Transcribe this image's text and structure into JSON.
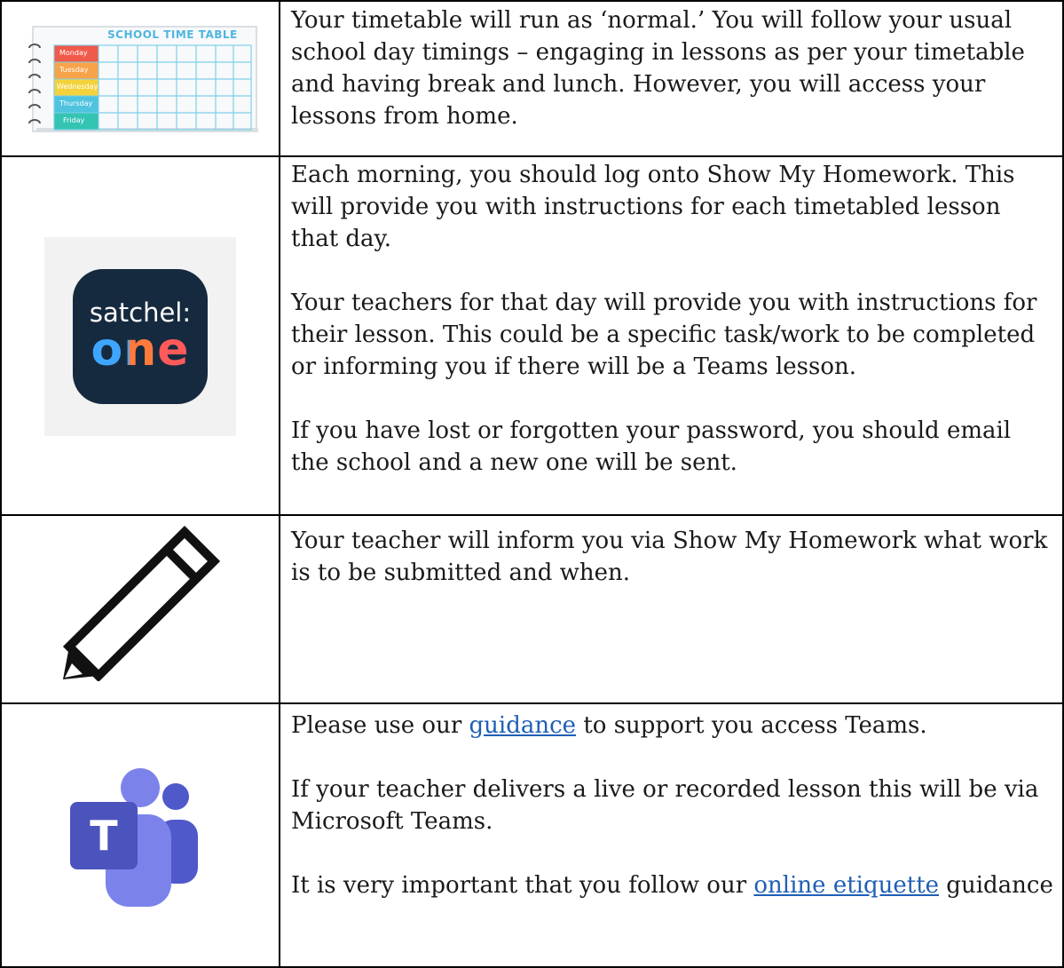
{
  "rows": [
    {
      "icon": "timetable-icon",
      "image_title": "SCHOOL TIME TABLE",
      "days": [
        "Monday",
        "Tuesday",
        "Wednesday",
        "Thursday",
        "Friday"
      ],
      "day_colors": [
        "#f05a4a",
        "#f7a34a",
        "#f4d23c",
        "#4fc3e0",
        "#34c4b2"
      ],
      "paragraphs": [
        "Your timetable will run as ‘normal.’ You will follow your usual school day timings – engaging in lessons as per your timetable and having break and lunch. However, you will access your lessons from home."
      ]
    },
    {
      "icon": "satchel-one-logo",
      "logo_line1": "satchel:",
      "logo_line2": "one",
      "paragraphs": [
        "Each morning, you should log onto Show My Homework. This will provide you with instructions for each timetabled lesson that day.",
        "Your teachers for that day will provide you with instructions for their lesson. This could be a specific task/work to be completed or informing you if there will be a Teams lesson.",
        "If you have lost or forgotten your password, you should email the school and a new one will be sent."
      ]
    },
    {
      "icon": "pencil-icon",
      "paragraphs": [
        "Your teacher will inform you via Show My Homework what work is to be submitted and when."
      ]
    },
    {
      "icon": "microsoft-teams-icon",
      "p1_before": "Please use our ",
      "p1_link": "guidance",
      "p1_after": " to support you access Teams.",
      "p2": "If your teacher delivers a live or recorded lesson this will be via Microsoft Teams.",
      "p3_before": "It is very important that you follow our ",
      "p3_link": "online etiquette",
      "p3_after": " guidance"
    }
  ]
}
